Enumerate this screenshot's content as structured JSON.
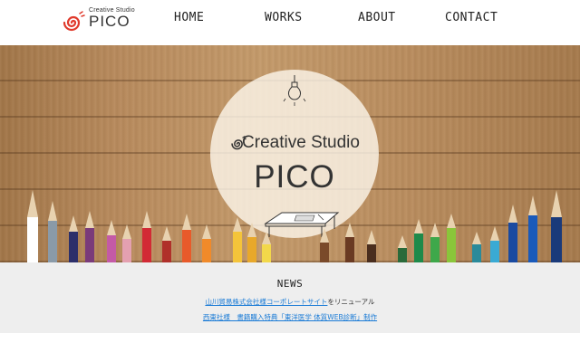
{
  "brand": {
    "logo_subtitle": "Creative Studio",
    "logo_name": "PICO",
    "accent_color": "#e03a2c"
  },
  "nav": {
    "items": [
      {
        "label": "HOME"
      },
      {
        "label": "WORKS"
      },
      {
        "label": "ABOUT"
      },
      {
        "label": "CONTACT"
      }
    ]
  },
  "hero": {
    "tagline": "Creative Studio",
    "title": "PICO",
    "icons": [
      "lightbulb-icon",
      "desk-icon",
      "swirl-icon"
    ]
  },
  "news": {
    "heading": "NEWS",
    "items": [
      {
        "link": "山川貿易株式会社様コーポレートサイト",
        "suffix": "をリニューアル"
      },
      {
        "link": "西東社様　書籍購入特典「東洋医学 体質WEB診断」制作",
        "suffix": ""
      }
    ]
  },
  "colors": {
    "link": "#1a7bd6",
    "news_background": "#eeeeee",
    "wood": "#b88a5c"
  }
}
